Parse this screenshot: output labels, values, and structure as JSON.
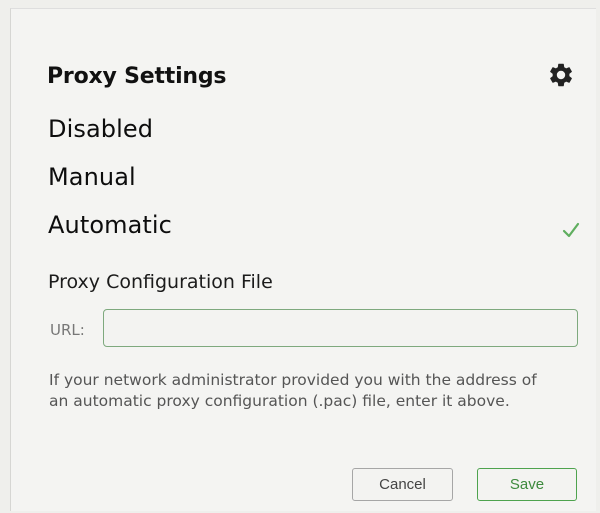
{
  "dialog": {
    "title": "Proxy Settings",
    "settings_icon": "gear-icon"
  },
  "options": {
    "disabled_label": "Disabled",
    "manual_label": "Manual",
    "automatic_label": "Automatic",
    "selected": "Automatic",
    "selected_icon": "checkmark-icon"
  },
  "config_file": {
    "heading": "Proxy Configuration File",
    "url_label": "URL:",
    "url_value": "",
    "help_text": "If your network administrator provided you with the address of an automatic proxy configuration (.pac) file, enter it above."
  },
  "buttons": {
    "cancel_label": "Cancel",
    "save_label": "Save"
  },
  "colors": {
    "accent": "#4ea34e",
    "text": "#111111",
    "muted_text": "#555555"
  }
}
